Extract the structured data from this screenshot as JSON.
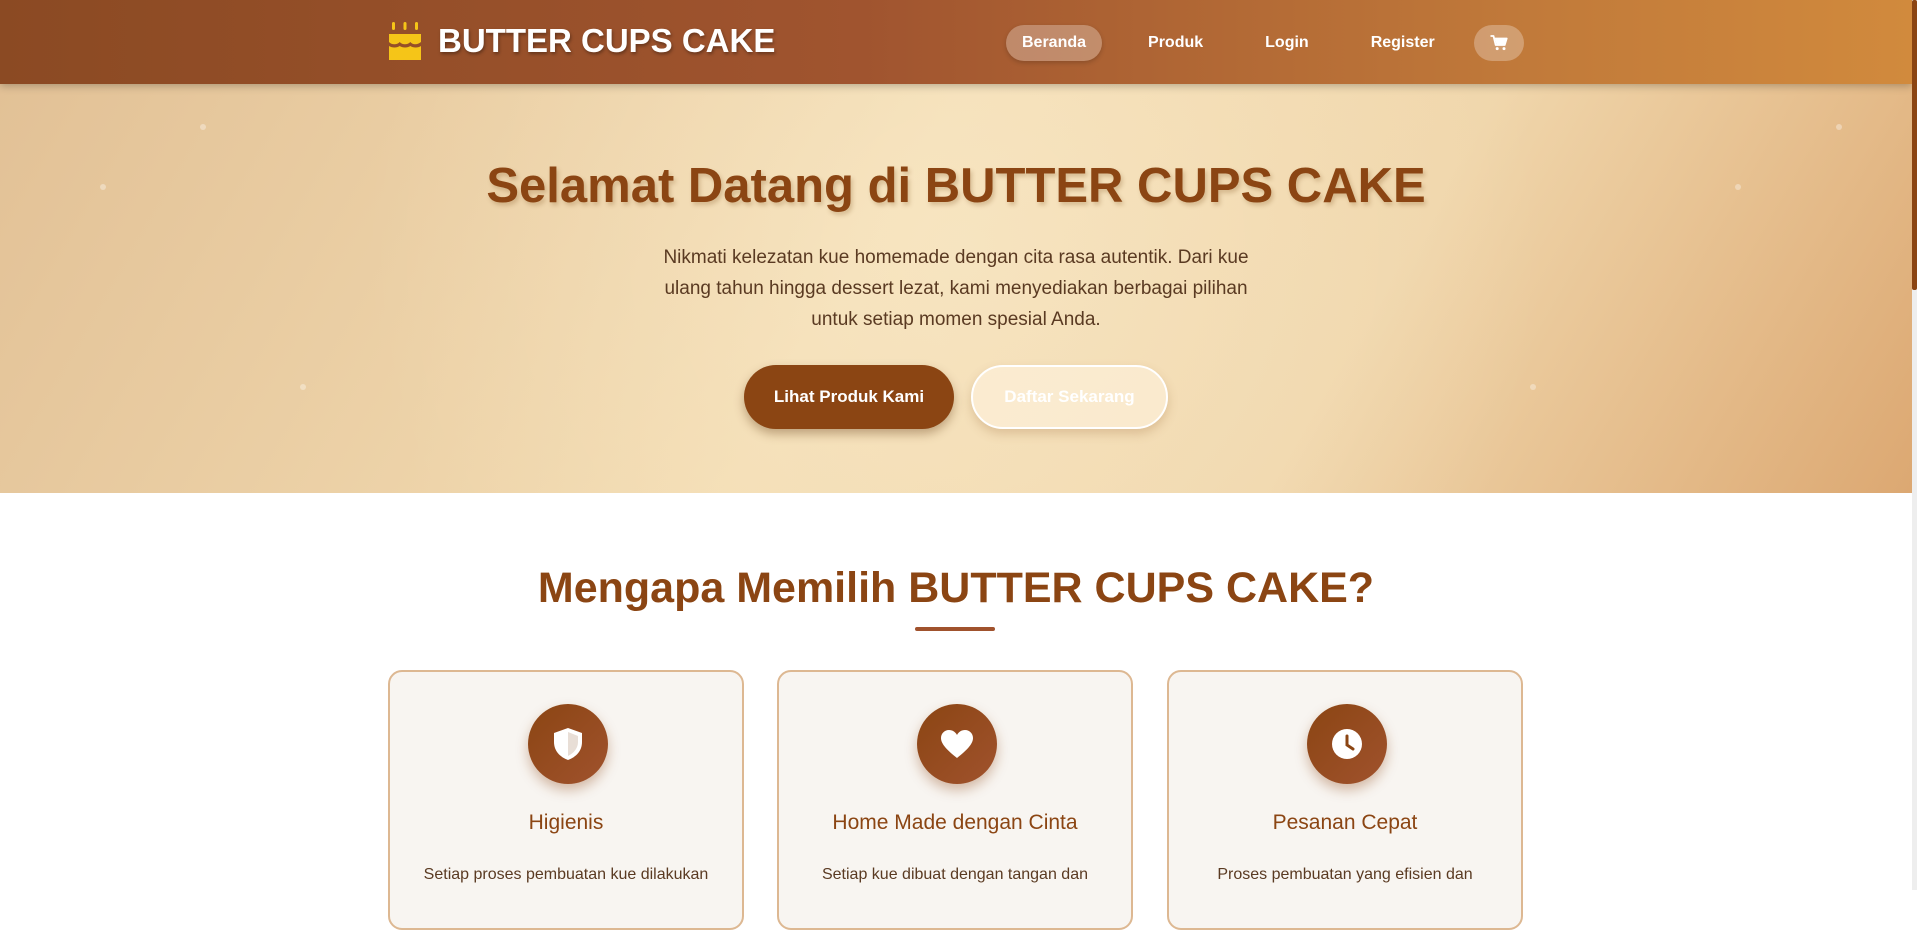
{
  "brand": {
    "name": "BUTTER CUPS CAKE",
    "logo_icon": "birthday-cake-icon"
  },
  "nav": {
    "items": [
      {
        "label": "Beranda",
        "active": true
      },
      {
        "label": "Produk",
        "active": false
      },
      {
        "label": "Login",
        "active": false
      },
      {
        "label": "Register",
        "active": false
      }
    ],
    "cart_icon": "shopping-cart-icon"
  },
  "hero": {
    "title": "Selamat Datang di BUTTER CUPS CAKE",
    "description": "Nikmati kelezatan kue homemade dengan cita rasa autentik. Dari kue ulang tahun hingga dessert lezat, kami menyediakan berbagai pilihan untuk setiap momen spesial Anda.",
    "primary_button": "Lihat Produk Kami",
    "secondary_button": "Daftar Sekarang"
  },
  "features": {
    "title": "Mengapa Memilih BUTTER CUPS CAKE?",
    "cards": [
      {
        "icon": "shield-icon",
        "title": "Higienis",
        "description": "Setiap proses pembuatan kue dilakukan"
      },
      {
        "icon": "heart-icon",
        "title": "Home Made dengan Cinta",
        "description": "Setiap kue dibuat dengan tangan dan"
      },
      {
        "icon": "clock-icon",
        "title": "Pesanan Cepat",
        "description": "Proses pembuatan yang efisien dan"
      }
    ]
  },
  "colors": {
    "primary": "#8b4513",
    "nav_gradient_start": "#8b4a23",
    "nav_gradient_end": "#d18a3d",
    "hero_bg": "#f3dcb2",
    "card_border": "#ddb892",
    "logo": "#f5c518"
  }
}
